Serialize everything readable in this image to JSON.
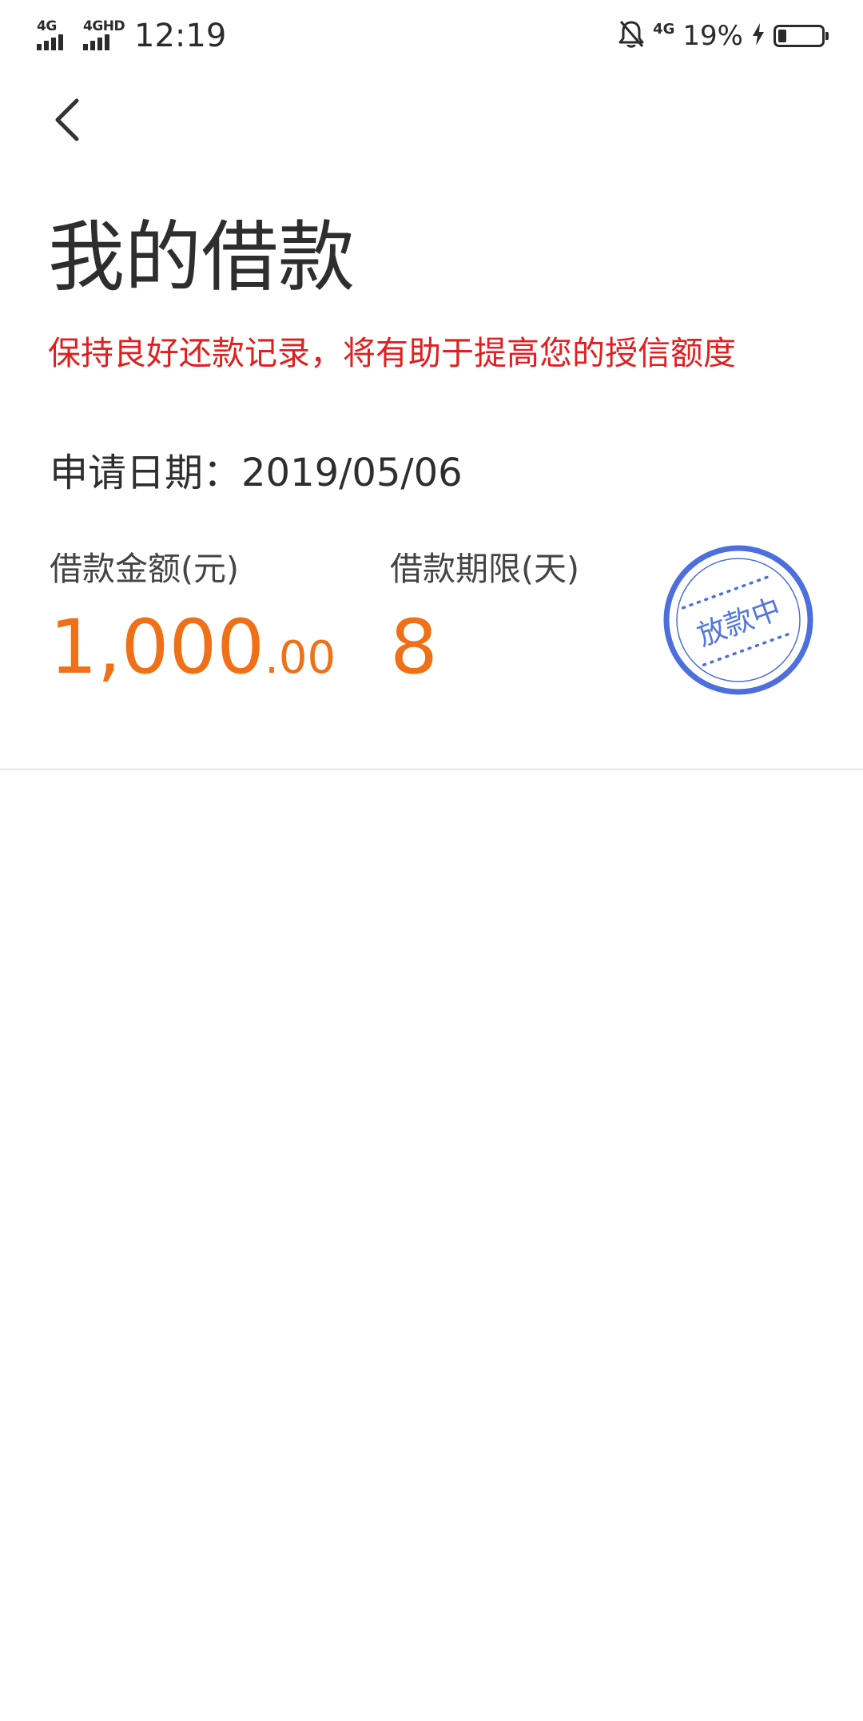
{
  "status_bar": {
    "network_1": "4G",
    "network_2": "4GHD",
    "time": "12:19",
    "network_3": "4G",
    "battery_percent": "19%",
    "battery_level": 0.19,
    "icons": [
      "signal-icon",
      "signal-icon",
      "bell-off-icon",
      "charging-icon",
      "battery-icon"
    ]
  },
  "header": {
    "back_icon": "chevron-left-icon",
    "title": "我的借款",
    "tip": "保持良好还款记录，将有助于提高您的授信额度"
  },
  "loan": {
    "apply_date_label": "申请日期：",
    "apply_date": "2019/05/06",
    "amount_label": "借款金额(元)",
    "amount_integer": "1,000",
    "amount_decimal": ".00",
    "term_label": "借款期限(天)",
    "term_value": "8",
    "status": "放款中"
  },
  "colors": {
    "tip": "#e02020",
    "value_accent": "#f07018",
    "stamp": "#4c6fdd",
    "stamp_text": "#5577dd",
    "divider": "#e6e6e6"
  }
}
